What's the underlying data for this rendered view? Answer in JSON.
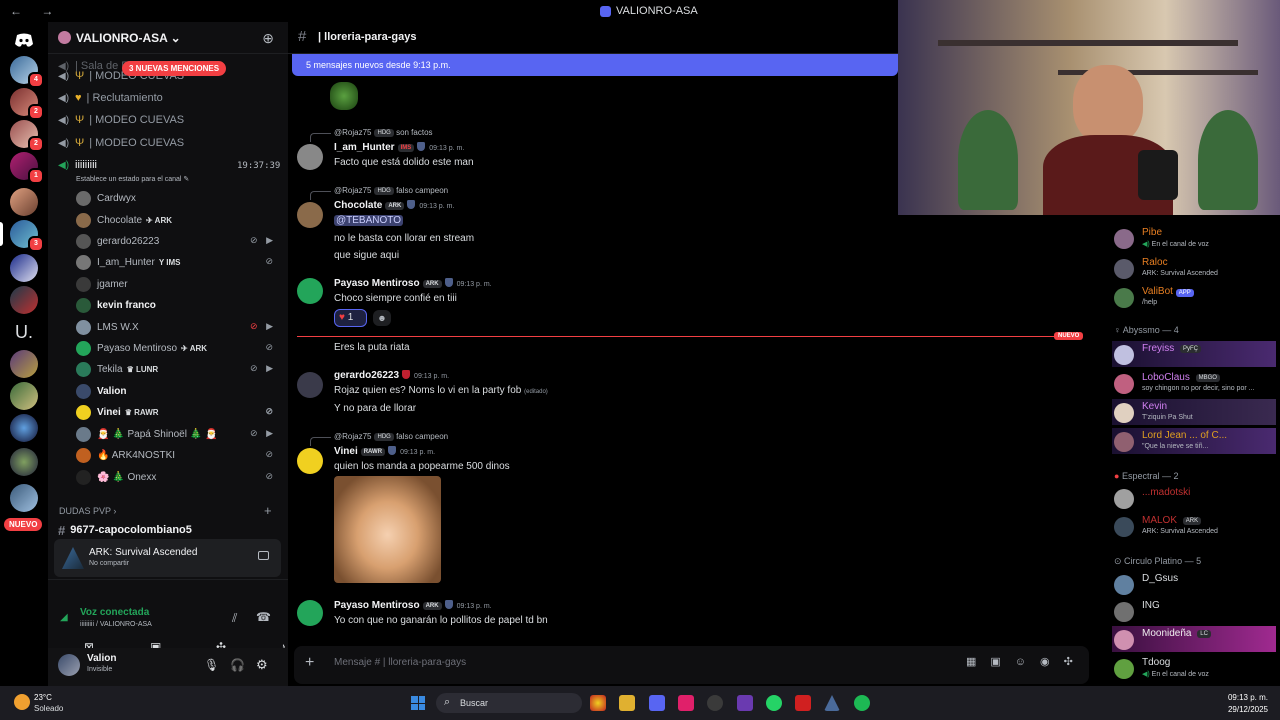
{
  "window": {
    "title": "VALIONRO-ASA",
    "nav": "← →"
  },
  "guilds": {
    "new_label": "NUEVO",
    "badges": [
      "4",
      "2",
      "2",
      "1",
      "3"
    ]
  },
  "server": {
    "name": "VALIONRO-ASA",
    "mentions_pill": "3 NUEVAS MENCIONES",
    "channels": [
      {
        "label": "| Sala de Espera"
      },
      {
        "label": "| MODEO CUEVAS"
      },
      {
        "label": "| Reclutamiento"
      },
      {
        "label": "| MODEO CUEVAS"
      },
      {
        "label": "| MODEO CUEVAS"
      }
    ],
    "voice_channel": {
      "name": "iiiiiiiii",
      "timer": "19:37:39",
      "status": "Establece un estado para el canal"
    },
    "voice_users": [
      {
        "name": "Cardwyx",
        "tag": ""
      },
      {
        "name": "Chocolate",
        "tag": "ARK"
      },
      {
        "name": "gerardo26223",
        "tag": ""
      },
      {
        "name": "I_am_Hunter",
        "tag": "IMS"
      },
      {
        "name": "jgamer",
        "tag": ""
      },
      {
        "name": "kevin franco",
        "tag": ""
      },
      {
        "name": "LMS W.X",
        "tag": ""
      },
      {
        "name": "Payaso Mentiroso",
        "tag": "ARK"
      },
      {
        "name": "Tekila",
        "tag": "LUNR"
      },
      {
        "name": "Valion",
        "tag": ""
      },
      {
        "name": "Vinei",
        "tag": "RAWR"
      },
      {
        "name": "Papá Shinoël",
        "tag": ""
      },
      {
        "name": "ARK4NOSTKI",
        "tag": ""
      },
      {
        "name": "Onexx",
        "tag": ""
      }
    ],
    "category": "DUDAS PVP",
    "next_channel": "9677-capocolombiano5"
  },
  "activity": {
    "game": "ARK: Survival Ascended",
    "sub": "No compartir"
  },
  "voice": {
    "status": "Voz conectada",
    "location": "iiiiiiiii / VALIONRO-ASA"
  },
  "user": {
    "name": "Valion",
    "status": "Invisible"
  },
  "chat": {
    "channel": "| lloreria-para-gays",
    "new_messages": "5 mensajes nuevos desde 9:13 p.m.",
    "new_divider": "NUEVO",
    "messages": [
      {
        "reply": "@Rojaz75",
        "reply_tag": "HDG",
        "reply_text": "son factos",
        "user": "I_am_Hunter",
        "tag": "IMS",
        "time": "09:13 p. m.",
        "lines": [
          "Facto que está dolido este man"
        ]
      },
      {
        "reply": "@Rojaz75",
        "reply_tag": "HDG",
        "reply_text": "falso campeon",
        "user": "Chocolate",
        "tag": "ARK",
        "time": "09:13 p. m.",
        "lines": [
          "@TEBANOTO",
          "no le basta con llorar en stream",
          "que sigue aqui"
        ]
      },
      {
        "user": "Payaso Mentiroso",
        "tag": "ARK",
        "time": "09:13 p. m.",
        "lines": [
          "Choco siempre confié en tiii"
        ],
        "reaction": "1"
      },
      {
        "lines": [
          "Eres la puta riata"
        ]
      },
      {
        "user": "gerardo26223",
        "time": "09:13 p. m.",
        "lines": [
          "Rojaz quien es? Noms lo vi en la party fob",
          "Y no para de llorar"
        ],
        "edited": "(editado)"
      },
      {
        "reply": "@Rojaz75",
        "reply_tag": "HDG",
        "reply_text": "falso campeon",
        "user": "Vinei",
        "tag": "RAWR",
        "time": "09:13 p. m.",
        "lines": [
          "quien los manda a popearme 500 dinos"
        ]
      },
      {
        "user": "Payaso Mentiroso",
        "tag": "ARK",
        "time": "09:13 p. m.",
        "lines": [
          "Yo con que no ganarán lo pollitos de papel td bn"
        ]
      }
    ],
    "composer_placeholder": "Mensaje #  | lloreria-para-gays"
  },
  "members": {
    "top": [
      {
        "name": "Pibe",
        "status": "En el canal de voz",
        "color": "#e67e22"
      },
      {
        "name": "Raloc",
        "status": "ARK: Survival Ascended",
        "color": "#e67e22"
      },
      {
        "name": "ValiBot",
        "status": "/help",
        "color": "#e67e22",
        "app": "APP"
      }
    ],
    "cat1": "Abyssmo — 4",
    "abyssmo": [
      {
        "name": "Freyiss",
        "status": "",
        "tag": "PyFÇ"
      },
      {
        "name": "LoboClaus",
        "status": "soy chingon no por decir, sino por ...",
        "tag": "MBGO"
      },
      {
        "name": "Kevin",
        "status": "T'ziquin Pa Shut",
        "tag": ""
      },
      {
        "name": "Lord Jean ... of C...",
        "status": "\"Que la nieve se tiñ...",
        "tag": ""
      }
    ],
    "cat2": "Espectral — 2",
    "espectral": [
      {
        "name": "...madotski",
        "status": ""
      },
      {
        "name": "MALOK",
        "status": "ARK: Survival Ascended",
        "tag": "ARK"
      }
    ],
    "cat3": "Circulo Platino — 5",
    "platino": [
      {
        "name": "D_Gsus",
        "status": ""
      },
      {
        "name": "ING",
        "status": ""
      },
      {
        "name": "Moonideña",
        "status": "",
        "tag": "LC"
      },
      {
        "name": "Tdoog",
        "status": "En el canal de voz"
      }
    ]
  },
  "taskbar": {
    "weather_temp": "23°C",
    "weather_desc": "Soleado",
    "search": "Buscar",
    "time": "09:13 p. m.",
    "date": "29/12/2025"
  }
}
